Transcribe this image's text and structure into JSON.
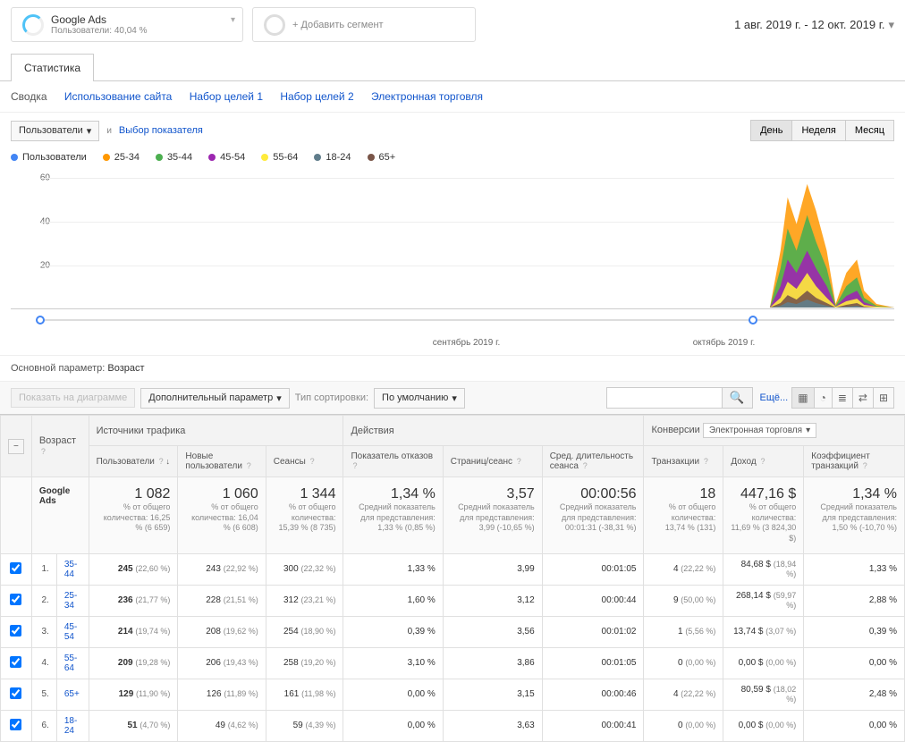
{
  "segment": {
    "title": "Google Ads",
    "subtitle": "Пользователи: 40,04 %"
  },
  "add_segment": "+ Добавить сегмент",
  "date_range": "1 авг. 2019 г. - 12 окт. 2019 г.",
  "tab": "Статистика",
  "subnav": [
    "Сводка",
    "Использование сайта",
    "Набор целей 1",
    "Набор целей 2",
    "Электронная торговля"
  ],
  "metric_dropdown": "Пользователи",
  "vs": "и",
  "choose_metric": "Выбор показателя",
  "time_toggle": [
    "День",
    "Неделя",
    "Месяц"
  ],
  "legend": [
    {
      "label": "Пользователи",
      "color": "#4285f4"
    },
    {
      "label": "25-34",
      "color": "#ff9800"
    },
    {
      "label": "35-44",
      "color": "#4caf50"
    },
    {
      "label": "45-54",
      "color": "#9c27b0"
    },
    {
      "label": "55-64",
      "color": "#ffeb3b"
    },
    {
      "label": "18-24",
      "color": "#607d8b"
    },
    {
      "label": "65+",
      "color": "#795548"
    }
  ],
  "chart_data": {
    "type": "area",
    "ylim": [
      0,
      60
    ],
    "yticks": [
      20,
      40,
      60
    ],
    "x_labels": [
      "сентябрь 2019 г.",
      "октябрь 2019 г."
    ],
    "series": [
      {
        "name": "Пользователи",
        "color": "#4285f4"
      },
      {
        "name": "25-34",
        "color": "#ff9800"
      },
      {
        "name": "35-44",
        "color": "#4caf50"
      },
      {
        "name": "45-54",
        "color": "#9c27b0"
      },
      {
        "name": "55-64",
        "color": "#ffeb3b"
      },
      {
        "name": "18-24",
        "color": "#607d8b"
      },
      {
        "name": "65+",
        "color": "#795548"
      }
    ],
    "note": "Data concentrated in October 2019; flat near zero before",
    "approx_peak": 55
  },
  "primary_dim_label": "Основной параметр:",
  "primary_dim_value": "Возраст",
  "show_on_chart": "Показать на диаграмме",
  "secondary_dim": "Дополнительный параметр",
  "sort_type_label": "Тип сортировки:",
  "sort_type_value": "По умолчанию",
  "more": "Ещё...",
  "group_headers": {
    "age": "Возраст",
    "traffic": "Источники трафика",
    "actions": "Действия",
    "conversions": "Конверсии",
    "conv_select": "Электронная торговля"
  },
  "columns": [
    "Пользователи",
    "Новые пользователи",
    "Сеансы",
    "Показатель отказов",
    "Страниц/сеанс",
    "Сред. длительность сеанса",
    "Транзакции",
    "Доход",
    "Коэффициент транзакций"
  ],
  "summary_label": "Google Ads",
  "summary": {
    "users": {
      "v": "1 082",
      "sub": "% от общего количества: 16,25 % (6 659)"
    },
    "new_users": {
      "v": "1 060",
      "sub": "% от общего количества: 16,04 % (6 608)"
    },
    "sessions": {
      "v": "1 344",
      "sub": "% от общего количества: 15,39 % (8 735)"
    },
    "bounce": {
      "v": "1,34 %",
      "sub": "Средний показатель для представления: 1,33 % (0,85 %)"
    },
    "pages": {
      "v": "3,57",
      "sub": "Средний показатель для представления: 3,99 (-10,65 %)"
    },
    "duration": {
      "v": "00:00:56",
      "sub": "Средний показатель для представления: 00:01:31 (-38,31 %)"
    },
    "trans": {
      "v": "18",
      "sub": "% от общего количества: 13,74 % (131)"
    },
    "revenue": {
      "v": "447,16 $",
      "sub": "% от общего количества: 11,69 % (3 824,30 $)"
    },
    "conv_rate": {
      "v": "1,34 %",
      "sub": "Средний показатель для представления: 1,50 % (-10,70 %)"
    }
  },
  "rows": [
    {
      "idx": "1.",
      "age": "35-44",
      "users": "245",
      "users_p": "(22,60 %)",
      "new": "243",
      "new_p": "(22,92 %)",
      "sess": "300",
      "sess_p": "(22,32 %)",
      "bounce": "1,33 %",
      "pages": "3,99",
      "dur": "00:01:05",
      "trans": "4",
      "trans_p": "(22,22 %)",
      "rev": "84,68 $",
      "rev_p": "(18,94 %)",
      "cr": "1,33 %"
    },
    {
      "idx": "2.",
      "age": "25-34",
      "users": "236",
      "users_p": "(21,77 %)",
      "new": "228",
      "new_p": "(21,51 %)",
      "sess": "312",
      "sess_p": "(23,21 %)",
      "bounce": "1,60 %",
      "pages": "3,12",
      "dur": "00:00:44",
      "trans": "9",
      "trans_p": "(50,00 %)",
      "rev": "268,14 $",
      "rev_p": "(59,97 %)",
      "cr": "2,88 %"
    },
    {
      "idx": "3.",
      "age": "45-54",
      "users": "214",
      "users_p": "(19,74 %)",
      "new": "208",
      "new_p": "(19,62 %)",
      "sess": "254",
      "sess_p": "(18,90 %)",
      "bounce": "0,39 %",
      "pages": "3,56",
      "dur": "00:01:02",
      "trans": "1",
      "trans_p": "(5,56 %)",
      "rev": "13,74 $",
      "rev_p": "(3,07 %)",
      "cr": "0,39 %"
    },
    {
      "idx": "4.",
      "age": "55-64",
      "users": "209",
      "users_p": "(19,28 %)",
      "new": "206",
      "new_p": "(19,43 %)",
      "sess": "258",
      "sess_p": "(19,20 %)",
      "bounce": "3,10 %",
      "pages": "3,86",
      "dur": "00:01:05",
      "trans": "0",
      "trans_p": "(0,00 %)",
      "rev": "0,00 $",
      "rev_p": "(0,00 %)",
      "cr": "0,00 %"
    },
    {
      "idx": "5.",
      "age": "65+",
      "users": "129",
      "users_p": "(11,90 %)",
      "new": "126",
      "new_p": "(11,89 %)",
      "sess": "161",
      "sess_p": "(11,98 %)",
      "bounce": "0,00 %",
      "pages": "3,15",
      "dur": "00:00:46",
      "trans": "4",
      "trans_p": "(22,22 %)",
      "rev": "80,59 $",
      "rev_p": "(18,02 %)",
      "cr": "2,48 %"
    },
    {
      "idx": "6.",
      "age": "18-24",
      "users": "51",
      "users_p": "(4,70 %)",
      "new": "49",
      "new_p": "(4,62 %)",
      "sess": "59",
      "sess_p": "(4,39 %)",
      "bounce": "0,00 %",
      "pages": "3,63",
      "dur": "00:00:41",
      "trans": "0",
      "trans_p": "(0,00 %)",
      "rev": "0,00 $",
      "rev_p": "(0,00 %)",
      "cr": "0,00 %"
    }
  ]
}
